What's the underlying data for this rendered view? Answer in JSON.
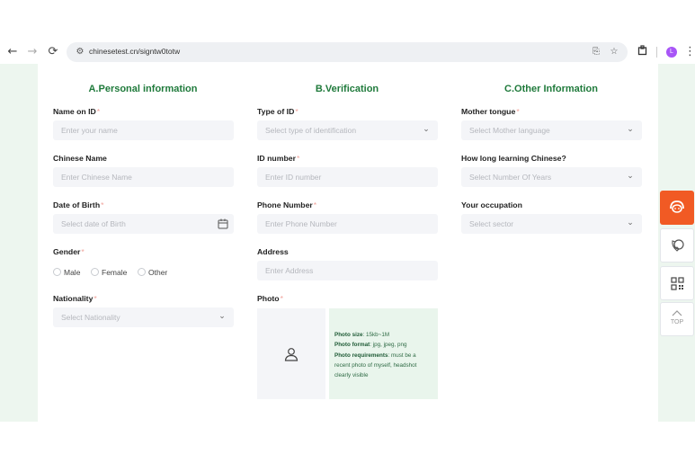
{
  "browser": {
    "url": "chinesetest.cn/signtw0totw",
    "profile_initial": "L",
    "back_icon": "←",
    "forward_icon": "→",
    "reload_icon": "⟳"
  },
  "sections": {
    "personal_title": "A.Personal information",
    "verification_title": "B.Verification",
    "other_title": "C.Other Information"
  },
  "personal": {
    "name_label": "Name on ID",
    "name_placeholder": "Enter your name",
    "chinese_name_label": "Chinese Name",
    "chinese_name_placeholder": "Enter Chinese Name",
    "dob_label": "Date of Birth",
    "dob_placeholder": "Select date of Birth",
    "gender_label": "Gender",
    "gender_options": [
      "Male",
      "Female",
      "Other"
    ],
    "nationality_label": "Nationality",
    "nationality_placeholder": "Select Nationality"
  },
  "verification": {
    "id_type_label": "Type of ID",
    "id_type_placeholder": "Select type of identification",
    "id_number_label": "ID number",
    "id_number_placeholder": "Enter ID number",
    "phone_label": "Phone Number",
    "phone_placeholder": "Enter Phone Number",
    "address_label": "Address",
    "address_placeholder": "Enter Address",
    "photo_label": "Photo",
    "photo_size_label": "Photo size",
    "photo_size_value": ": 15kb~1M",
    "photo_format_label": "Photo format",
    "photo_format_value": ": jpg, jpeg, png",
    "photo_req_label": "Photo requirements",
    "photo_req_value": ": must be a recent photo of myself, headshot clearly visible"
  },
  "other": {
    "tongue_label": "Mother tongue",
    "tongue_placeholder": "Select Mother language",
    "learning_label": "How long learning Chinese?",
    "learning_placeholder": "Select Number Of Years",
    "occupation_label": "Your occupation",
    "occupation_placeholder": "Select sector"
  },
  "required_marker": "*",
  "side_toolbar": {
    "top_label": "TOP"
  },
  "colors": {
    "accent_green": "#1f7a3b",
    "page_bg": "#edf6ef",
    "side_orange": "#f15a24"
  }
}
